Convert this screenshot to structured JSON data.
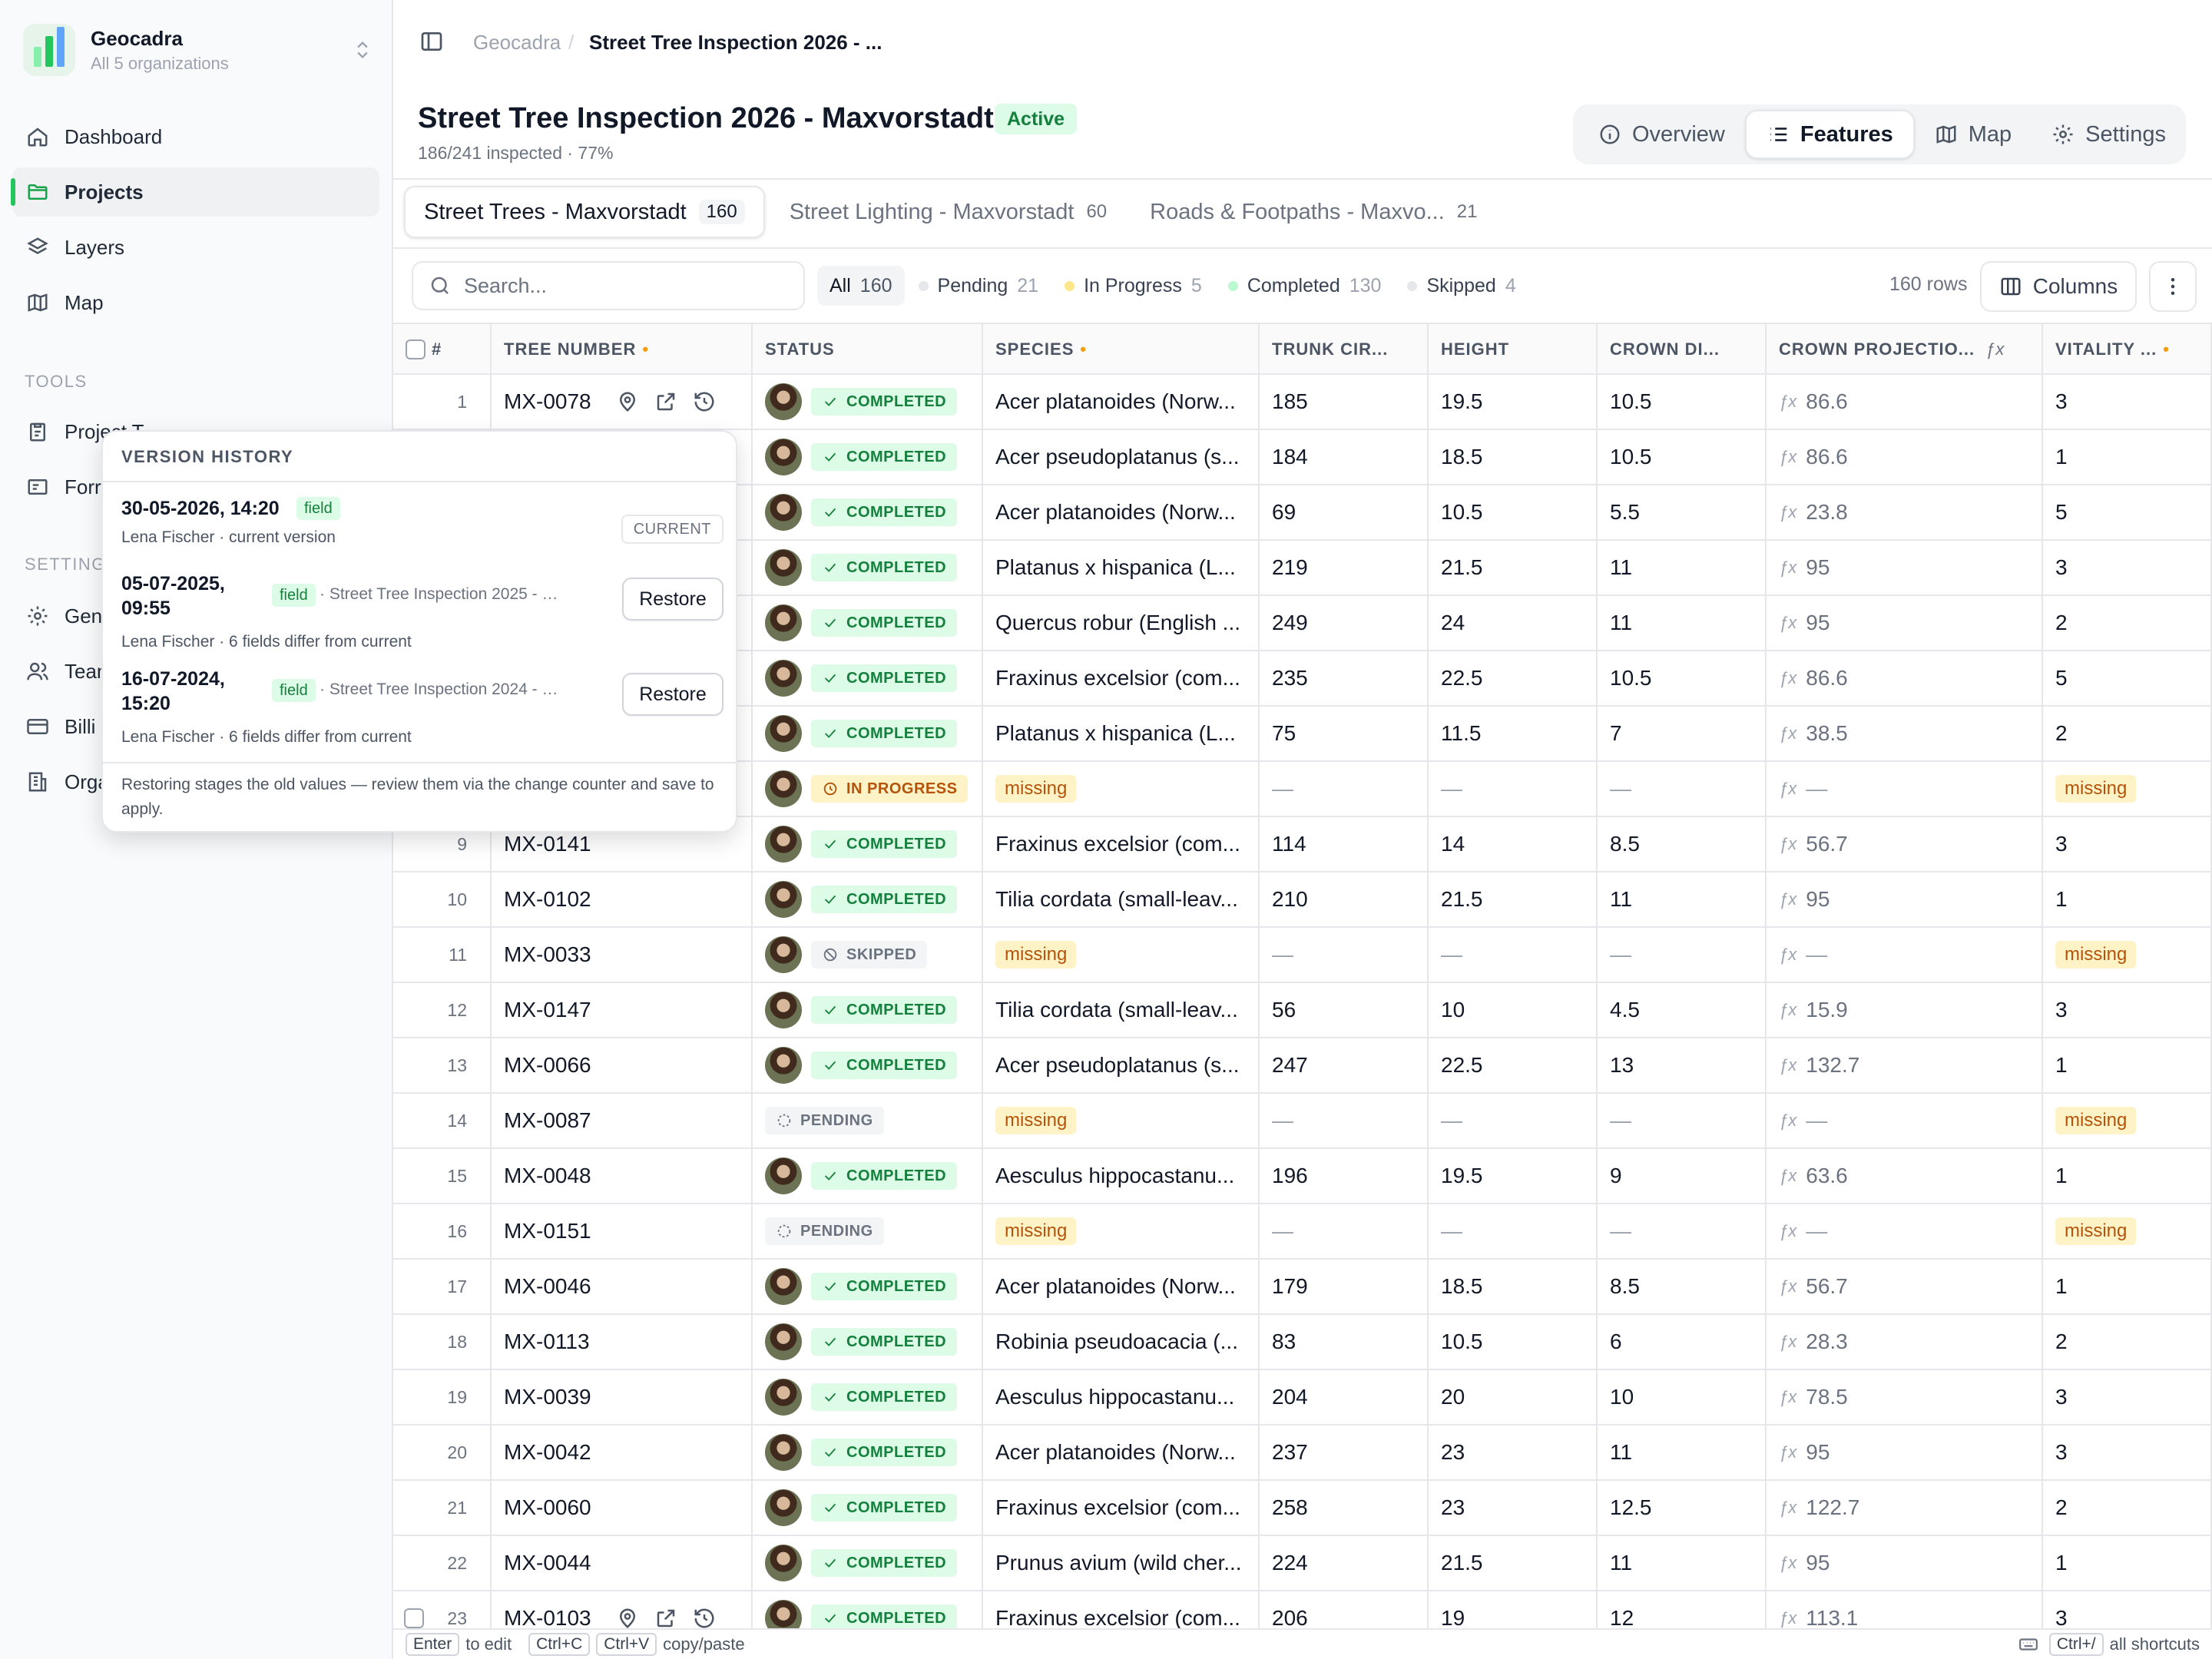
{
  "org": {
    "name": "Geocadra",
    "sub": "All 5 organizations"
  },
  "nav": {
    "items": [
      {
        "label": "Dashboard",
        "icon": "home-icon"
      },
      {
        "label": "Projects",
        "icon": "folder-icon",
        "active": true
      },
      {
        "label": "Layers",
        "icon": "layers-icon"
      },
      {
        "label": "Map",
        "icon": "map-icon"
      }
    ],
    "tools_heading": "TOOLS",
    "tools": [
      {
        "label": "Project T",
        "icon": "clipboard-icon"
      },
      {
        "label": "Forr",
        "icon": "form-icon"
      }
    ],
    "settings_heading": "SETTING",
    "settings": [
      {
        "label": "Gen",
        "icon": "gear-icon"
      },
      {
        "label": "Tean",
        "icon": "users-icon"
      },
      {
        "label": "Billi",
        "icon": "card-icon"
      },
      {
        "label": "Orga",
        "icon": "building-icon"
      }
    ]
  },
  "breadcrumb": {
    "root": "Geocadra",
    "sep": "/",
    "current": "Street Tree Inspection 2026 - ..."
  },
  "project": {
    "title": "Street Tree Inspection 2026 - Maxvorstadt",
    "badge": "Active",
    "progress": "186/241 inspected · 77%",
    "progress_fraction": 0.77
  },
  "viewtabs": [
    {
      "label": "Overview",
      "icon": "info-icon"
    },
    {
      "label": "Features",
      "icon": "list-icon",
      "active": true
    },
    {
      "label": "Map",
      "icon": "map-icon"
    },
    {
      "label": "Settings",
      "icon": "gear-icon"
    }
  ],
  "layertabs": [
    {
      "label": "Street Trees - Maxvorstadt",
      "count": "160",
      "active": true
    },
    {
      "label": "Street Lighting - Maxvorstadt",
      "count": "60"
    },
    {
      "label": "Roads & Footpaths - Maxvo...",
      "count": "21"
    }
  ],
  "search": {
    "placeholder": "Search..."
  },
  "filters": [
    {
      "label": "All",
      "count": "160",
      "active": true,
      "color": ""
    },
    {
      "label": "Pending",
      "count": "21",
      "color": "#e5e7eb"
    },
    {
      "label": "In Progress",
      "count": "5",
      "color": "#fde68a"
    },
    {
      "label": "Completed",
      "count": "130",
      "color": "#bbf7d0"
    },
    {
      "label": "Skipped",
      "count": "4",
      "color": "#e5e7eb"
    }
  ],
  "rowcount": "160 rows",
  "columns_label": "Columns",
  "columns": [
    {
      "label": "#"
    },
    {
      "label": "TREE NUMBER",
      "required": "•"
    },
    {
      "label": "STATUS"
    },
    {
      "label": "SPECIES",
      "required": "•"
    },
    {
      "label": "TRUNK CIR..."
    },
    {
      "label": "HEIGHT"
    },
    {
      "label": "CROWN DI..."
    },
    {
      "label": "CROWN PROJECTIO...",
      "formula": "ƒx"
    },
    {
      "label": "VITALITY ...",
      "required": "•"
    }
  ],
  "rows": [
    {
      "n": "1",
      "id": "MX-0078",
      "status": "COMPLETED",
      "species": "Acer platanoides (Norw...",
      "trunk": "185",
      "height": "19.5",
      "crown": "10.5",
      "proj": "86.6",
      "vit": "3"
    },
    {
      "n": "2",
      "id": "",
      "status": "COMPLETED",
      "species": "Acer pseudoplatanus (s...",
      "trunk": "184",
      "height": "18.5",
      "crown": "10.5",
      "proj": "86.6",
      "vit": "1"
    },
    {
      "n": "3",
      "id": "",
      "status": "COMPLETED",
      "species": "Acer platanoides (Norw...",
      "trunk": "69",
      "height": "10.5",
      "crown": "5.5",
      "proj": "23.8",
      "vit": "5"
    },
    {
      "n": "4",
      "id": "",
      "status": "COMPLETED",
      "species": "Platanus x hispanica (L...",
      "trunk": "219",
      "height": "21.5",
      "crown": "11",
      "proj": "95",
      "vit": "3"
    },
    {
      "n": "5",
      "id": "",
      "status": "COMPLETED",
      "species": "Quercus robur (English ...",
      "trunk": "249",
      "height": "24",
      "crown": "11",
      "proj": "95",
      "vit": "2"
    },
    {
      "n": "6",
      "id": "",
      "status": "COMPLETED",
      "species": "Fraxinus excelsior (com...",
      "trunk": "235",
      "height": "22.5",
      "crown": "10.5",
      "proj": "86.6",
      "vit": "5"
    },
    {
      "n": "7",
      "id": "",
      "status": "COMPLETED",
      "species": "Platanus x hispanica (L...",
      "trunk": "75",
      "height": "11.5",
      "crown": "7",
      "proj": "38.5",
      "vit": "2"
    },
    {
      "n": "8",
      "id": "",
      "status": "IN PROGRESS",
      "species": "missing",
      "trunk": "—",
      "height": "—",
      "crown": "—",
      "proj": "—",
      "vit": "missing"
    },
    {
      "n": "9",
      "id": "MX-0141",
      "status": "COMPLETED",
      "species": "Fraxinus excelsior (com...",
      "trunk": "114",
      "height": "14",
      "crown": "8.5",
      "proj": "56.7",
      "vit": "3"
    },
    {
      "n": "10",
      "id": "MX-0102",
      "status": "COMPLETED",
      "species": "Tilia cordata (small-leav...",
      "trunk": "210",
      "height": "21.5",
      "crown": "11",
      "proj": "95",
      "vit": "1"
    },
    {
      "n": "11",
      "id": "MX-0033",
      "status": "SKIPPED",
      "species": "missing",
      "trunk": "—",
      "height": "—",
      "crown": "—",
      "proj": "—",
      "vit": "missing"
    },
    {
      "n": "12",
      "id": "MX-0147",
      "status": "COMPLETED",
      "species": "Tilia cordata (small-leav...",
      "trunk": "56",
      "height": "10",
      "crown": "4.5",
      "proj": "15.9",
      "vit": "3"
    },
    {
      "n": "13",
      "id": "MX-0066",
      "status": "COMPLETED",
      "species": "Acer pseudoplatanus (s...",
      "trunk": "247",
      "height": "22.5",
      "crown": "13",
      "proj": "132.7",
      "vit": "1"
    },
    {
      "n": "14",
      "id": "MX-0087",
      "status": "PENDING",
      "species": "missing",
      "trunk": "—",
      "height": "—",
      "crown": "—",
      "proj": "—",
      "vit": "missing"
    },
    {
      "n": "15",
      "id": "MX-0048",
      "status": "COMPLETED",
      "species": "Aesculus hippocastanu...",
      "trunk": "196",
      "height": "19.5",
      "crown": "9",
      "proj": "63.6",
      "vit": "1"
    },
    {
      "n": "16",
      "id": "MX-0151",
      "status": "PENDING",
      "species": "missing",
      "trunk": "—",
      "height": "—",
      "crown": "—",
      "proj": "—",
      "vit": "missing"
    },
    {
      "n": "17",
      "id": "MX-0046",
      "status": "COMPLETED",
      "species": "Acer platanoides (Norw...",
      "trunk": "179",
      "height": "18.5",
      "crown": "8.5",
      "proj": "56.7",
      "vit": "1"
    },
    {
      "n": "18",
      "id": "MX-0113",
      "status": "COMPLETED",
      "species": "Robinia pseudoacacia (...",
      "trunk": "83",
      "height": "10.5",
      "crown": "6",
      "proj": "28.3",
      "vit": "2"
    },
    {
      "n": "19",
      "id": "MX-0039",
      "status": "COMPLETED",
      "species": "Aesculus hippocastanu...",
      "trunk": "204",
      "height": "20",
      "crown": "10",
      "proj": "78.5",
      "vit": "3"
    },
    {
      "n": "20",
      "id": "MX-0042",
      "status": "COMPLETED",
      "species": "Acer platanoides (Norw...",
      "trunk": "237",
      "height": "23",
      "crown": "11",
      "proj": "95",
      "vit": "3"
    },
    {
      "n": "21",
      "id": "MX-0060",
      "status": "COMPLETED",
      "species": "Fraxinus excelsior (com...",
      "trunk": "258",
      "height": "23",
      "crown": "12.5",
      "proj": "122.7",
      "vit": "2"
    },
    {
      "n": "22",
      "id": "MX-0044",
      "status": "COMPLETED",
      "species": "Prunus avium (wild cher...",
      "trunk": "224",
      "height": "21.5",
      "crown": "11",
      "proj": "95",
      "vit": "1"
    },
    {
      "n": "23",
      "id": "MX-0103",
      "status": "COMPLETED",
      "species": "Fraxinus excelsior (com...",
      "trunk": "206",
      "height": "19",
      "crown": "12",
      "proj": "113.1",
      "vit": "3"
    }
  ],
  "footer": {
    "enter_key": "Enter",
    "enter_text": "to edit",
    "copy_key": "Ctrl+C",
    "paste_key": "Ctrl+V",
    "copy_text": "copy/paste",
    "shortcut_key": "Ctrl+/",
    "shortcut_text": "all shortcuts"
  },
  "popover": {
    "title": "VERSION HISTORY",
    "versions": [
      {
        "date": "30-05-2026, 14:20",
        "tag": "field",
        "project": "",
        "who": "Lena Fischer · current version",
        "action": "CURRENT"
      },
      {
        "date": "05-07-2025,",
        "time": "09:55",
        "tag": "field",
        "project": "· Street Tree Inspection 2025 - Max...",
        "who": "Lena Fischer · 6 fields differ from current",
        "action": "Restore"
      },
      {
        "date": "16-07-2024,",
        "time": "15:20",
        "tag": "field",
        "project": "· Street Tree Inspection 2024 - Max...",
        "who": "Lena Fischer · 6 fields differ from current",
        "action": "Restore"
      }
    ],
    "note": "Restoring stages the old values — review them via the change counter and save to apply."
  }
}
